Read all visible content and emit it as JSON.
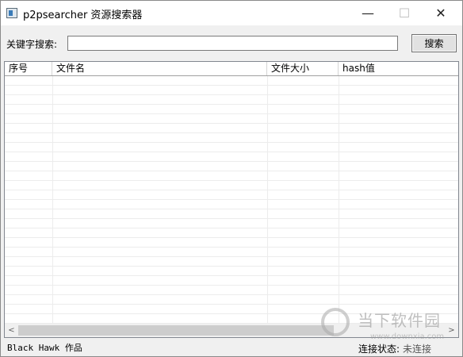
{
  "window": {
    "title": "p2psearcher 资源搜索器",
    "minimize_glyph": "—",
    "maximize_glyph": "☐",
    "close_glyph": "✕"
  },
  "search": {
    "label": "关键字搜索:",
    "input_value": "",
    "button_label": "搜索"
  },
  "table": {
    "columns": [
      "序号",
      "文件名",
      "文件大小",
      "hash值"
    ],
    "rows": []
  },
  "scrollbar": {
    "left_arrow": "<",
    "right_arrow": ">"
  },
  "footer": {
    "credit": "Black Hawk 作品",
    "status_label": "连接状态:",
    "status_value": "未连接"
  },
  "watermark": {
    "text_cn": "当下软件园",
    "text_en": "www.downxia.com"
  }
}
